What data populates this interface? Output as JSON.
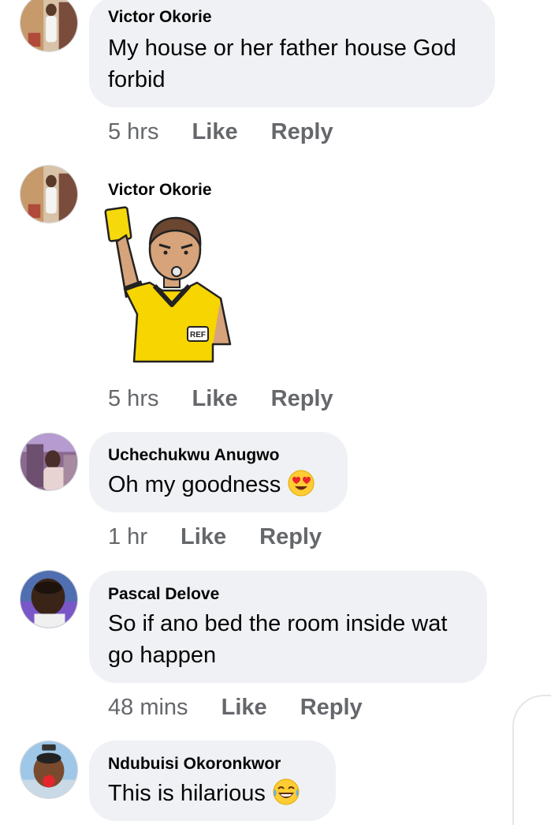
{
  "comments": [
    {
      "author": "Victor Okorie",
      "text": "My house or her father house God forbid",
      "time": "5 hrs",
      "like_label": "Like",
      "reply_label": "Reply"
    },
    {
      "author": "Victor Okorie",
      "sticker": "referee-yellow-card-sticker",
      "sticker_text": "REF",
      "time": "5 hrs",
      "like_label": "Like",
      "reply_label": "Reply"
    },
    {
      "author": "Uchechukwu Anugwo",
      "text": "Oh my goodness",
      "emoji": "heart-eyes-emoji",
      "time": "1 hr",
      "like_label": "Like",
      "reply_label": "Reply"
    },
    {
      "author": "Pascal Delove",
      "text": "So if ano bed the room inside wat go happen",
      "time": "48 mins",
      "like_label": "Like",
      "reply_label": "Reply"
    },
    {
      "author": "Ndubuisi Okoronkwor",
      "text": "This is hilarious",
      "emoji": "tears-of-joy-emoji"
    }
  ],
  "colors": {
    "bubble": "#eff1f4",
    "meta_text": "#65676b",
    "referee_shirt": "#f7d500",
    "yellow_card": "#f5d90a"
  }
}
